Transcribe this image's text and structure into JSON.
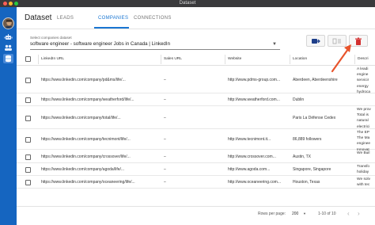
{
  "window": {
    "title": "Dataset"
  },
  "app": {
    "title": "Dataset"
  },
  "tabs": [
    {
      "label": "LEADS"
    },
    {
      "label": "COMPANIES"
    },
    {
      "label": "CONNECTIONS"
    }
  ],
  "dataset_select": {
    "label": "Select companies dataset",
    "value": "software engineer - software engineer Jobs in Canada | LinkedIn"
  },
  "table": {
    "headers": [
      "LinkedIn URL",
      "Sales URL",
      "Website",
      "Location",
      "Descri"
    ],
    "rows": [
      {
        "linkedin": "https://www.linkedin.com/company/pd&ms/life/...",
        "sales": "–",
        "website": "http://www.pdms-group.com...",
        "location": "Aberdeen, Aberdeenshire",
        "desc": [
          "A leadi",
          "engine",
          "servicir",
          "energy",
          "hydroca"
        ]
      },
      {
        "linkedin": "https://www.linkedin.com/company/weatherford/life/...",
        "sales": "–",
        "website": "http://www.weatherford.com...",
        "location": "Dublin",
        "desc": []
      },
      {
        "linkedin": "https://www.linkedin.com/company/total/life/...",
        "sales": "–",
        "website": "",
        "location": "Paris La Défense Cedex",
        "desc": [
          "We prov",
          "Total is",
          "natural",
          "electrici"
        ]
      },
      {
        "linkedin": "https://www.linkedin.com/company/tecnimont/life/...",
        "sales": "–",
        "website": "http://www.tecnimont.it...",
        "location": "86,889 followers",
        "desc": [
          "The EP",
          "The Ma",
          "enginee",
          "Innovat"
        ]
      },
      {
        "linkedin": "https://www.linkedin.com/company/crossover/life/...",
        "sales": "–",
        "website": "http://www.crossover.com...",
        "location": "Austin, TX",
        "desc": [
          "We Buil"
        ]
      },
      {
        "linkedin": "https://www.linkedin.com/company/agoda/life/...",
        "sales": "–",
        "website": "http://www.agoda.com...",
        "location": "Singapore, Singapore",
        "desc": [
          "Transfo",
          "holiday"
        ]
      },
      {
        "linkedin": "https://www.linkedin.com/company/oceaneering/life/...",
        "sales": "–",
        "website": "http://www.oceaneering.com...",
        "location": "Houston, Texas",
        "desc": [
          "We solv",
          "with tec"
        ]
      }
    ]
  },
  "pagination": {
    "rows_per_page_label": "Rows per page:",
    "rows_per_page_value": "200",
    "range": "1-10 of 10"
  },
  "colors": {
    "primary": "#1976d2",
    "sidebar": "#1565c0",
    "delete": "#d32f2f",
    "annotation_arrow": "#e8542c"
  },
  "icons": {
    "sidebar": [
      "avatar",
      "robot-icon",
      "people-icon",
      "dataset-icon"
    ],
    "toolbar": [
      "export-icon",
      "columns-icon",
      "delete-icon"
    ]
  }
}
